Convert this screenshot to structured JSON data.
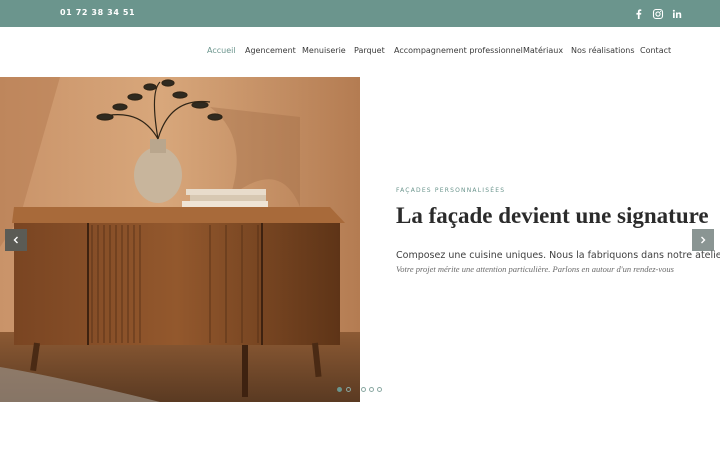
{
  "topbar": {
    "phone": "01 72 38 34 51",
    "background": "#6b958d",
    "social": [
      {
        "name": "facebook-icon"
      },
      {
        "name": "instagram-icon"
      },
      {
        "name": "linkedin-icon"
      }
    ]
  },
  "nav": {
    "items": [
      {
        "label": "Accueil",
        "active": true
      },
      {
        "label": "Agencement",
        "active": false
      },
      {
        "label": "Menuiserie",
        "active": false
      },
      {
        "label": "Parquet",
        "active": false
      },
      {
        "label": "Accompagnement professionnel",
        "active": false
      },
      {
        "label": "Matériaux",
        "active": false
      },
      {
        "label": "Nos réalisations",
        "active": false
      },
      {
        "label": "Contact",
        "active": false
      }
    ]
  },
  "hero": {
    "eyebrow": "FAÇADES PERSONNALISÉES",
    "headline": "La façade devient une signature",
    "lead": "Composez une cuisine uniques. Nous la fabriquons dans notre atelier.",
    "sub": "Votre projet mérite une attention particulière. Parlons en autour d'un rendez-vous",
    "image_icon": "wooden-sideboard-photo",
    "prev_icon": "chevron-left-icon",
    "next_icon": "chevron-right-icon",
    "slides_total": 5,
    "current_slide": 1
  }
}
